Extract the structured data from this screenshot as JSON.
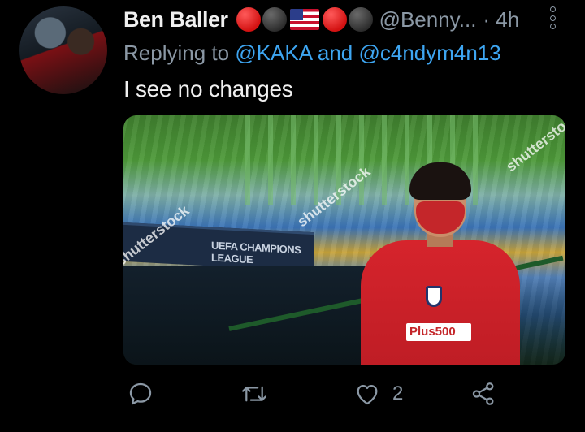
{
  "tweet": {
    "display_name": "Ben Baller",
    "name_emojis": [
      "red-circle",
      "black-circle",
      "us-flag",
      "red-circle",
      "black-circle"
    ],
    "handle": "@Benny...",
    "separator_time": "· 4h",
    "reply_prefix": "Replying to",
    "reply_mentions": "@KAKA and @c4ndym4n13",
    "text": "I see no changes",
    "media": {
      "watermark": "shutterstock",
      "banner_text": "UEFA CHAMPIONS LEAGUE",
      "sponsor_text": "Plus500"
    }
  },
  "actions": {
    "reply_icon": "reply-icon",
    "retweet_icon": "retweet-icon",
    "like_icon": "heart-icon",
    "like_count": "2",
    "share_icon": "share-icon"
  },
  "colors": {
    "background": "#000000",
    "text": "#e7e9ea",
    "muted": "#8b98a5",
    "accent": "#3ea6f2"
  }
}
